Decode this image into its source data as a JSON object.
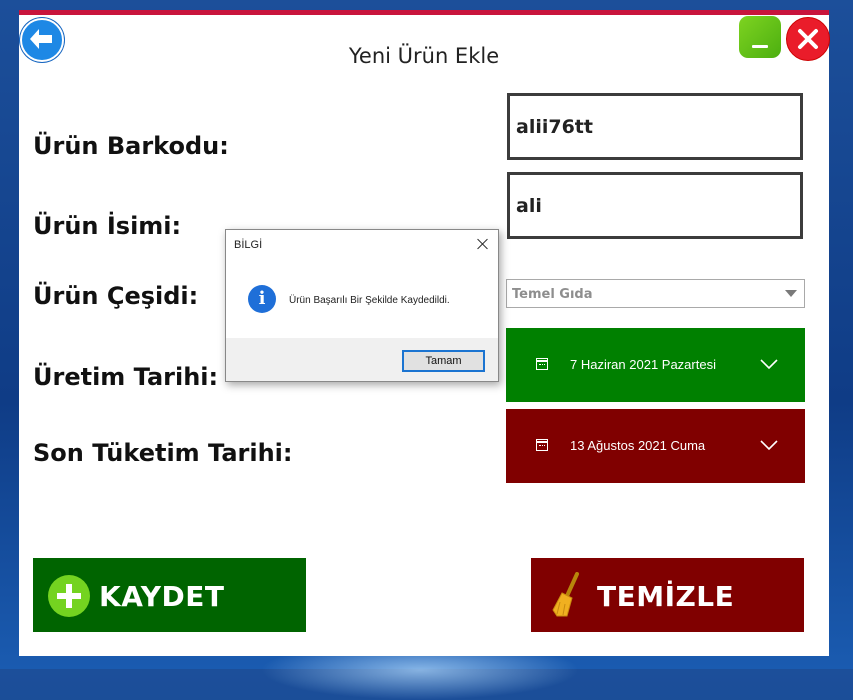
{
  "window": {
    "title": "Yeni Ürün Ekle",
    "accent_color": "#c8143c"
  },
  "form": {
    "barcode_label": "Ürün Barkodu:",
    "barcode_value": "alii76tt",
    "name_label": "Ürün İsimi:",
    "name_value": "ali",
    "type_label": "Ürün Çeşidi:",
    "type_value": "Temel Gıda",
    "production_label": "Üretim Tarihi:",
    "production_value": "7 Haziran 2021 Pazartesi",
    "production_color": "#008000",
    "expiry_label": "Son Tüketim Tarihi:",
    "expiry_value": "13 Ağustos 2021 Cuma",
    "expiry_color": "#800000"
  },
  "actions": {
    "save_label": "KAYDET",
    "save_color": "#006400",
    "clear_label": "TEMİZLE",
    "clear_color": "#800000"
  },
  "dialog": {
    "title": "BİLGİ",
    "message": "Ürün Başarılı Bir Şekilde Kaydedildi.",
    "ok_label": "Tamam",
    "icon": "info-icon"
  },
  "icons": {
    "back": "back-arrow-icon",
    "minimize": "minimize-icon",
    "close": "close-icon",
    "calendar": "calendar-icon",
    "chevron": "chevron-down-icon",
    "plus": "plus-icon",
    "broom": "broom-icon"
  }
}
